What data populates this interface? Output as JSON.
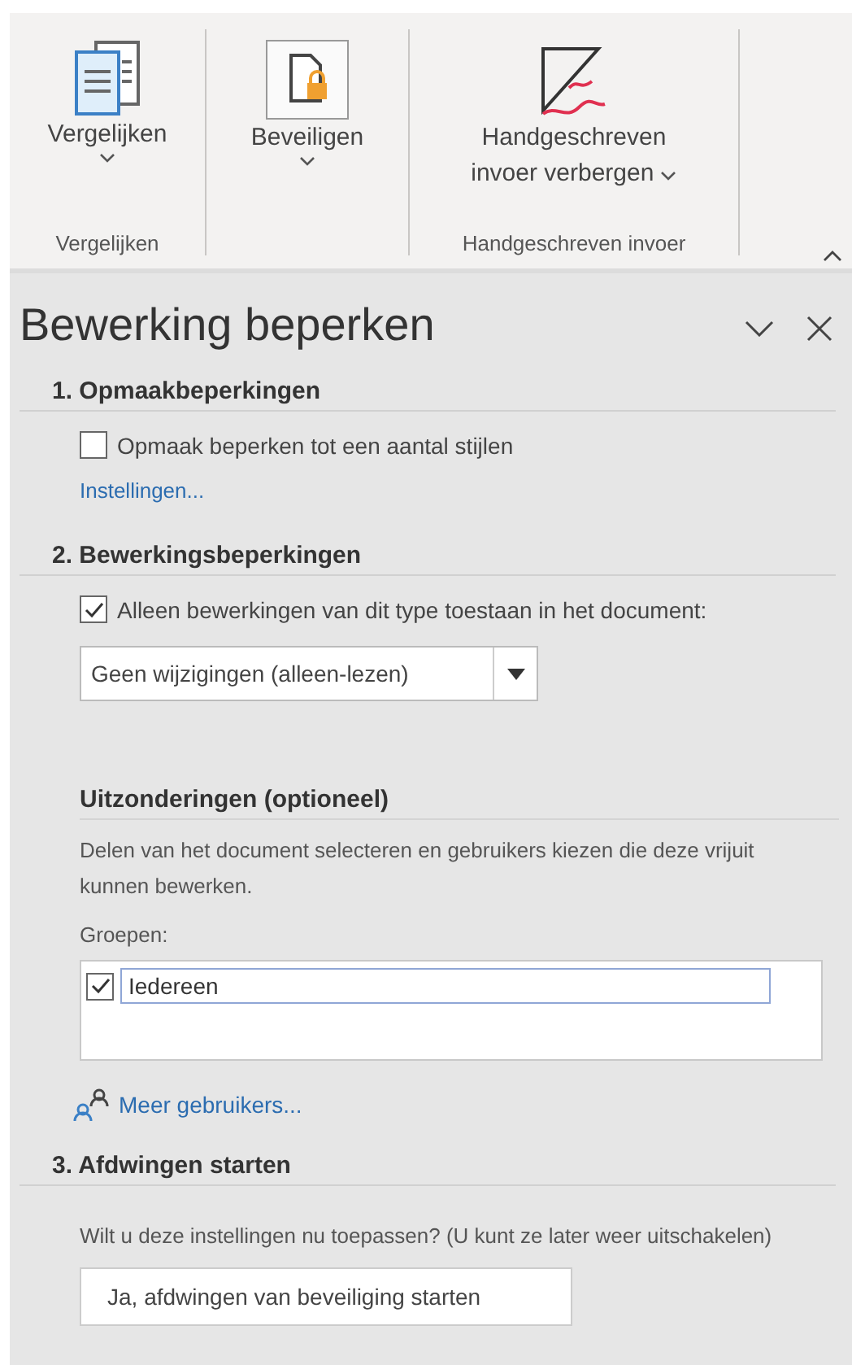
{
  "ribbon": {
    "groups": [
      {
        "label": "Vergelijken",
        "button": {
          "kind": "compare",
          "lines": [
            "Vergelijken"
          ],
          "dropdown": true
        }
      },
      {
        "button": {
          "kind": "protect",
          "lines": [
            "Beveiligen"
          ],
          "dropdown": true
        }
      },
      {
        "label": "Handgeschreven invoer",
        "button": {
          "kind": "ink",
          "lines": [
            "Handgeschreven",
            "invoer verbergen"
          ],
          "dropdown": true
        }
      }
    ]
  },
  "pane": {
    "title": "Bewerking beperken",
    "sections": [
      {
        "heading": "1. Opmaakbeperkingen",
        "items": [
          {
            "kind": "checkbox",
            "label": "Opmaak beperken tot een aantal stijlen",
            "checked": false
          },
          {
            "kind": "link",
            "label": "Instellingen..."
          }
        ]
      },
      {
        "heading": "2. Bewerkingsbeperkingen",
        "items": [
          {
            "kind": "checkbox",
            "label": "Alleen bewerkingen van dit type toestaan in het document:",
            "checked": true
          },
          {
            "kind": "dropdown",
            "value": "Geen wijzigingen (alleen-lezen)"
          },
          {
            "kind": "subheading",
            "label": "Uitzonderingen (optioneel)"
          },
          {
            "kind": "text",
            "label": "Delen van het document selecteren en gebruikers kiezen die deze vrijuit kunnen bewerken."
          },
          {
            "kind": "text",
            "label": "Groepen:"
          },
          {
            "kind": "listbox",
            "entries": [
              {
                "label": "Iedereen",
                "checked": true,
                "selected": true
              }
            ]
          },
          {
            "kind": "users_link",
            "label": "Meer gebruikers..."
          }
        ]
      },
      {
        "heading": "3. Afdwingen starten",
        "items": [
          {
            "kind": "text",
            "label": "Wilt u deze instellingen nu toepassen? (U kunt ze later weer uitschakelen)"
          },
          {
            "kind": "button",
            "label": "Ja, afdwingen van beveiliging starten"
          }
        ]
      }
    ]
  }
}
